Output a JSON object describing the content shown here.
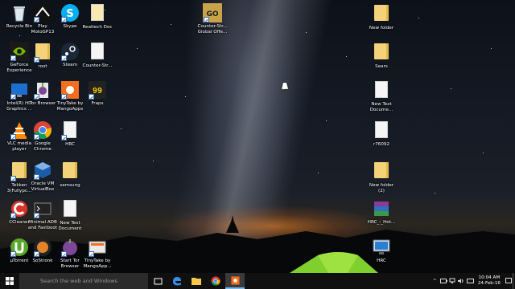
{
  "desktop": {
    "icons": [
      {
        "name": "recycle-bin",
        "label": "Recycle Bin"
      },
      {
        "name": "play-motogp13",
        "label": "Play\nMotoGP13"
      },
      {
        "name": "skype",
        "label": "Skype"
      },
      {
        "name": "realtech-doc",
        "label": "Realtech Doc"
      },
      {
        "name": "counter-strike-go",
        "label": "Counter-Str...\nGlobal Offe..."
      },
      {
        "name": "new-folder",
        "label": "New folder"
      },
      {
        "name": "geforce-experience",
        "label": "GeForce\nExperience"
      },
      {
        "name": "root",
        "label": "root"
      },
      {
        "name": "steam",
        "label": "Steam"
      },
      {
        "name": "counter-strike-doc",
        "label": "Counter-Str..."
      },
      {
        "name": "sears",
        "label": "Sears"
      },
      {
        "name": "intel-hd-graphics",
        "label": "Intel(R) HD\nGraphics ..."
      },
      {
        "name": "tor-browser",
        "label": "Tor Browser"
      },
      {
        "name": "tinytake",
        "label": "TinyTake by\nMangoApps"
      },
      {
        "name": "fraps",
        "label": "Fraps"
      },
      {
        "name": "new-text-document-1",
        "label": "New Text\nDocume..."
      },
      {
        "name": "vlc-media-player",
        "label": "VLC media\nplayer"
      },
      {
        "name": "google-chrome",
        "label": "Google\nChrome"
      },
      {
        "name": "hrc-doc",
        "label": "HRC"
      },
      {
        "name": "r76092",
        "label": "r76092"
      },
      {
        "name": "tekken-3",
        "label": "Tekken\n3(Fullypc..."
      },
      {
        "name": "oracle-vm-virtualbox",
        "label": "Oracle VM\nVirtualBox"
      },
      {
        "name": "samsung",
        "label": "samsung"
      },
      {
        "name": "new-folder-2",
        "label": "New folder\n(2)"
      },
      {
        "name": "ccleaner",
        "label": "CCleaner"
      },
      {
        "name": "minimal-adb",
        "label": "Minimal ADB\nand Fastboot"
      },
      {
        "name": "new-text-document-2",
        "label": "New Text\nDocument"
      },
      {
        "name": "hrc-hot",
        "label": "HRC_-_Hot..."
      },
      {
        "name": "utorrent",
        "label": "µTorrent"
      },
      {
        "name": "sostronk",
        "label": "SoStronk"
      },
      {
        "name": "start-tor-browser",
        "label": "Start Tor\nBrowser"
      },
      {
        "name": "tinytake-2",
        "label": "TinyTake by\nMangoApp..."
      },
      {
        "name": "hrc-pc",
        "label": "HRC"
      }
    ]
  },
  "taskbar": {
    "search_placeholder": "Search the web and Windows",
    "clock_time": "10:04 AM",
    "clock_date": "24-Feb-16"
  }
}
